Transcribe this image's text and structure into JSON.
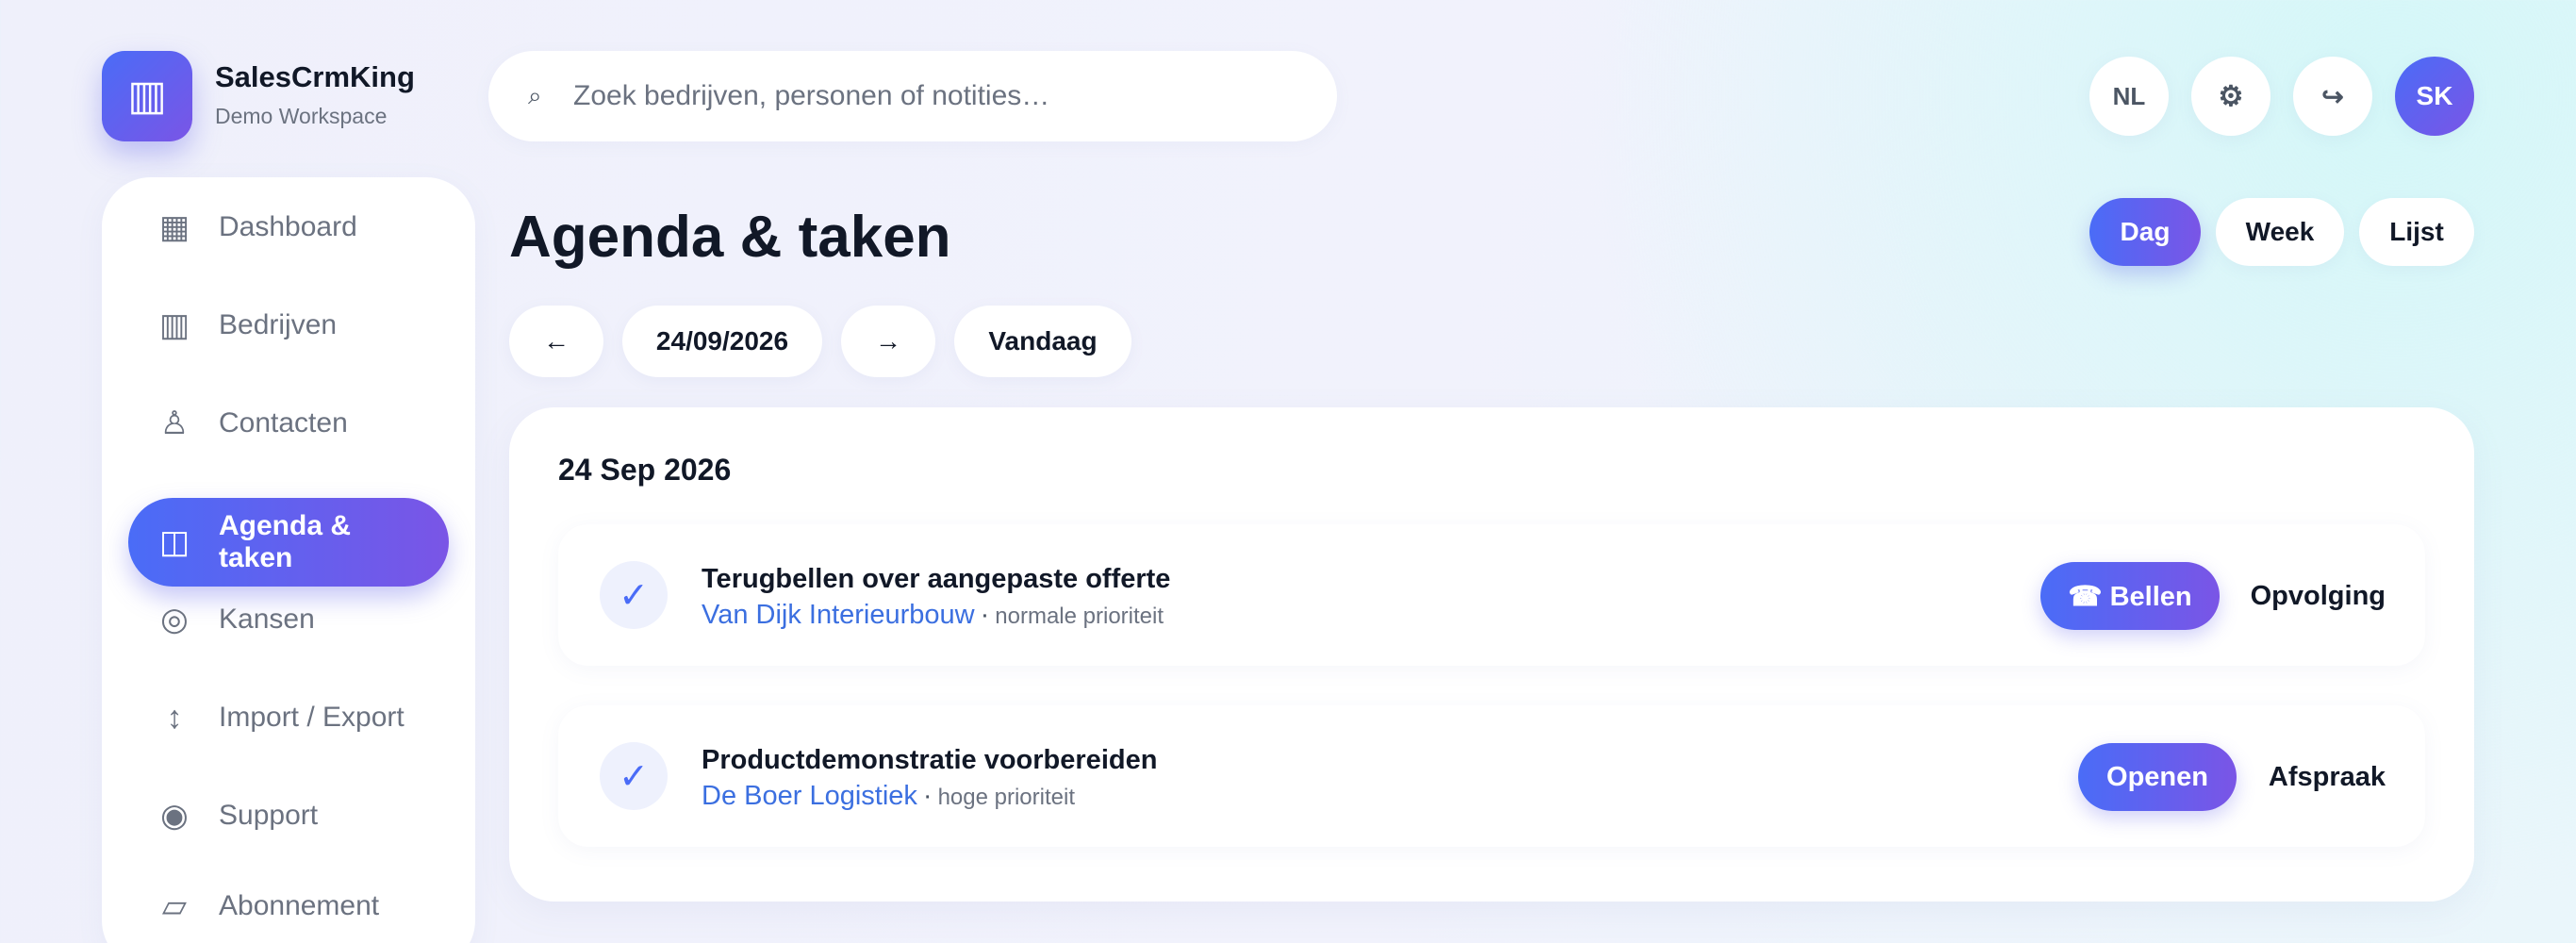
{
  "brand": {
    "logo_glyph": "▥",
    "name": "SalesCrmKing",
    "workspace": "Demo Workspace"
  },
  "search": {
    "glyph": "⌕",
    "placeholder": "Zoek bedrijven, personen of notities…",
    "value": ""
  },
  "header": {
    "language": "NL",
    "settings_glyph": "⚙",
    "logout_glyph": "↪",
    "avatar_initials": "SK"
  },
  "sidebar": {
    "items": [
      {
        "label": "Dashboard",
        "glyph": "▦",
        "icon": "dashboard-icon"
      },
      {
        "label": "Bedrijven",
        "glyph": "▥",
        "icon": "building-icon"
      },
      {
        "label": "Contacten",
        "glyph": "♙",
        "icon": "person-icon"
      },
      {
        "label": "Agenda & taken",
        "glyph": "◫",
        "icon": "calendar-icon",
        "active": true
      },
      {
        "label": "Kansen",
        "glyph": "◎",
        "icon": "target-icon"
      },
      {
        "label": "Import / Export",
        "glyph": "↕",
        "icon": "import-export-icon"
      },
      {
        "label": "Support",
        "glyph": "◉",
        "icon": "support-icon"
      },
      {
        "label": "Abonnement",
        "glyph": "▱",
        "icon": "subscription-icon"
      }
    ]
  },
  "main": {
    "title": "Agenda & taken",
    "views": [
      "Dag",
      "Week",
      "Lijst"
    ],
    "active_view": "Dag",
    "date_nav": {
      "prev": "←",
      "date": "24/09/2026",
      "next": "→",
      "today": "Vandaag"
    },
    "day": {
      "heading": "24 Sep 2026",
      "tasks": [
        {
          "check": "✓",
          "title": "Terugbellen over aangepaste offerte",
          "company": "Van Dijk Interieurbouw",
          "separator": "·",
          "priority": "normale prioriteit",
          "action": "☎ Bellen",
          "type": "Opvolging"
        },
        {
          "check": "✓",
          "title": "Productdemonstratie voorbereiden",
          "company": "De Boer Logistiek",
          "separator": "·",
          "priority": "hoge prioriteit",
          "action": "Openen",
          "type": "Afspraak"
        }
      ]
    }
  },
  "colors": {
    "accent_start": "#4a6cf7",
    "accent_end": "#7a55e6",
    "link": "#3b6fe0",
    "text": "#111827",
    "muted": "#6b7280"
  }
}
